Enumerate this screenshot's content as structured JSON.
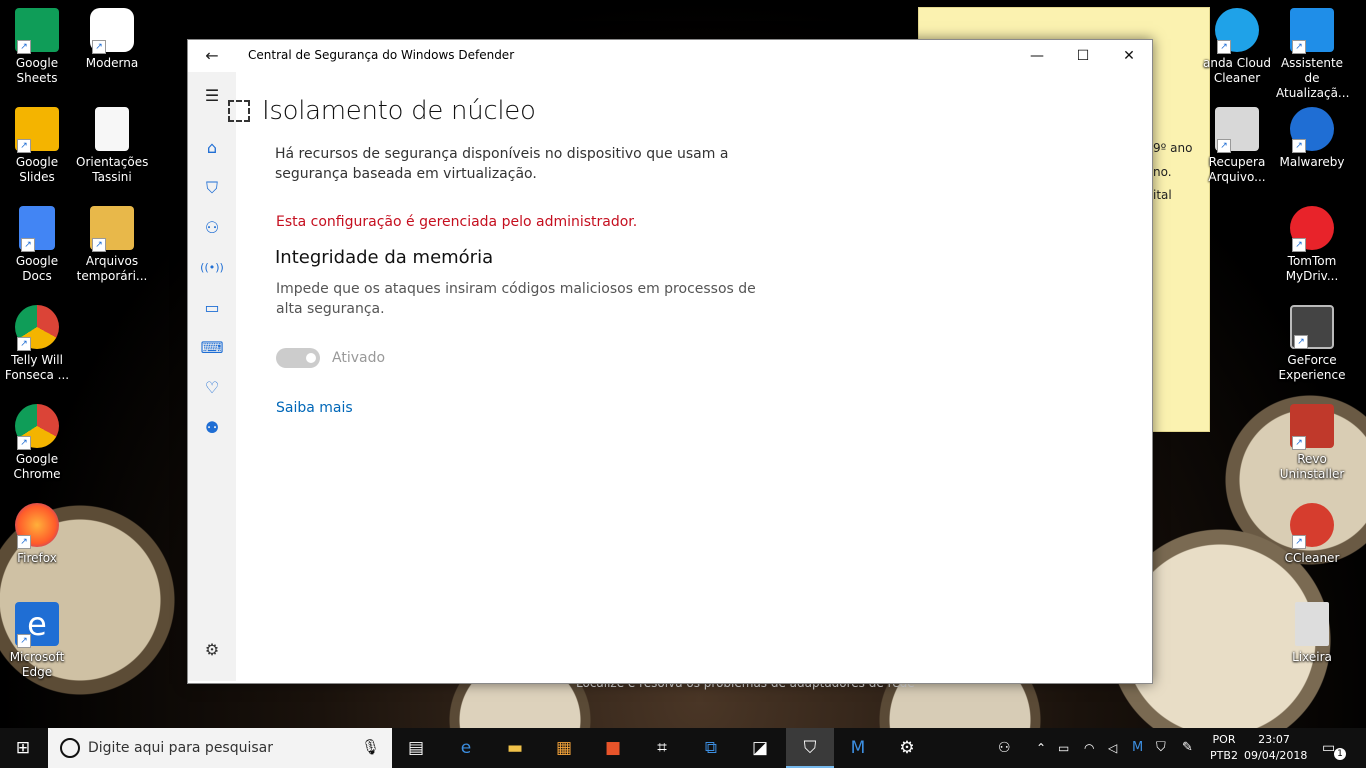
{
  "desktop": {
    "icons_left": [
      {
        "label": "Google Sheets",
        "line1": "Google",
        "line2": "Sheets",
        "icon": "google-sheets-icon",
        "color": "#0f9d58"
      },
      {
        "label": "Moderna",
        "line1": "Moderna",
        "line2": "",
        "icon": "moderna-icon",
        "color": "#ffffff"
      },
      {
        "label": "Google Slides",
        "line1": "Google Slides",
        "line2": "",
        "icon": "google-slides-icon",
        "color": "#f4b400"
      },
      {
        "label": "Orientações Tassini",
        "line1": "Orientações",
        "line2": "Tassini",
        "icon": "text-document-icon",
        "color": "#ffffff"
      },
      {
        "label": "Google Docs",
        "line1": "Google Docs",
        "line2": "",
        "icon": "google-docs-icon",
        "color": "#4285f4"
      },
      {
        "label": "Arquivos temporári...",
        "line1": "Arquivos",
        "line2": "temporári...",
        "icon": "folder-icon",
        "color": "#e8b84a"
      },
      {
        "label": "Telly Will Fonseca ...",
        "line1": "Telly Will",
        "line2": "Fonseca ...",
        "icon": "chrome-profile-icon",
        "color": "#db4437"
      },
      {
        "label": "Google Chrome",
        "line1": "Google",
        "line2": "Chrome",
        "icon": "chrome-icon",
        "color": "#db4437"
      },
      {
        "label": "Firefox",
        "line1": "Firefox",
        "line2": "",
        "icon": "firefox-icon",
        "color": "#ff7139"
      },
      {
        "label": "Microsoft Edge",
        "line1": "Microsoft",
        "line2": "Edge",
        "icon": "edge-icon",
        "color": "#1f6ed4"
      }
    ],
    "icons_right": [
      {
        "line1": "anda Cloud",
        "line2": "Cleaner",
        "icon": "panda-cloud-icon",
        "color": "#1fa2e8"
      },
      {
        "line1": "Assistente de",
        "line2": "Atualizaçã...",
        "icon": "windows-update-assistant-icon",
        "color": "#1f8ee8"
      },
      {
        "line1": "Recupera",
        "line2": "Arquivo...",
        "icon": "recovery-icon",
        "color": "#cccccc"
      },
      {
        "line1": "Malwareby",
        "line2": "",
        "icon": "malwarebytes-icon",
        "color": "#1f6ed4"
      },
      {
        "line1": "TomTom",
        "line2": "MyDriv...",
        "icon": "tomtom-icon",
        "color": "#e8232a"
      },
      {
        "line1": "GeForce",
        "line2": "Experience",
        "icon": "geforce-icon",
        "color": "#76b900"
      },
      {
        "line1": "Revo",
        "line2": "Uninstaller",
        "icon": "revo-icon",
        "color": "#c0392b"
      },
      {
        "line1": "CCleaner",
        "line2": "",
        "icon": "ccleaner-icon",
        "color": "#d63d2e"
      },
      {
        "line1": "Lixeira",
        "line2": "",
        "icon": "recycle-bin-icon",
        "color": "#dddddd"
      }
    ],
    "sticky_note_fragments": [
      "9º ano",
      "no.",
      "ital"
    ],
    "bottom_text": "Localize e resolva os problemas de adaptadores de rede"
  },
  "window": {
    "title": "Central de Segurança do Windows Defender",
    "back_glyph": "←",
    "minimize_glyph": "—",
    "maximize_glyph": "☐",
    "close_glyph": "✕",
    "page_title": "Isolamento de núcleo",
    "description": "Há recursos de segurança disponíveis no dispositivo que usam a segurança baseada em virtualização.",
    "admin_notice": "Esta configuração é gerenciada pelo administrador.",
    "section_title": "Integridade da memória",
    "section_desc": "Impede que os ataques insiram códigos maliciosos em processos de alta segurança.",
    "toggle_state": "Ativado",
    "toggle_on": true,
    "learn_more": "Saiba mais",
    "accent": "#0067b8",
    "warning_color": "#c50f1f"
  },
  "sidebar": {
    "items": [
      {
        "name": "menu-hamburger-icon",
        "glyph": "☰"
      },
      {
        "name": "home-icon",
        "glyph": "⌂"
      },
      {
        "name": "virus-protection-icon",
        "glyph": "⛉"
      },
      {
        "name": "account-protection-icon",
        "glyph": "⚇"
      },
      {
        "name": "firewall-network-icon",
        "glyph": "((•))"
      },
      {
        "name": "app-browser-control-icon",
        "glyph": "▭"
      },
      {
        "name": "device-security-icon",
        "glyph": "⌨"
      },
      {
        "name": "device-health-icon",
        "glyph": "♡"
      },
      {
        "name": "family-options-icon",
        "glyph": "⚉"
      },
      {
        "name": "settings-gear-icon",
        "glyph": "⚙"
      }
    ]
  },
  "taskbar": {
    "search_placeholder": "Digite aqui para pesquisar",
    "language_line1": "POR",
    "language_line2": "PTB2",
    "time": "23:07",
    "date": "09/04/2018",
    "notification_count": "1"
  }
}
